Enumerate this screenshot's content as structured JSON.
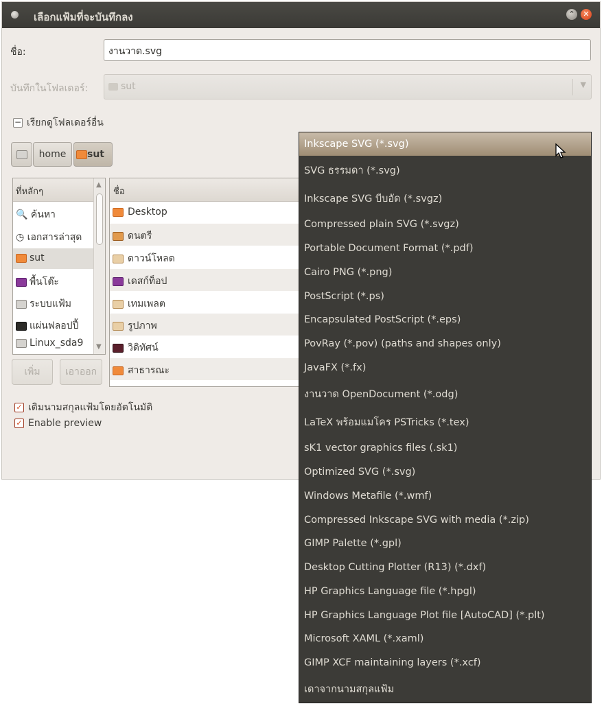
{
  "window": {
    "title": "เลือกแฟ้มที่จะบันทึกลง"
  },
  "form": {
    "name_label": "ชื่อ:",
    "name_value": "งานวาด.svg",
    "folder_label": "บันทึกในโฟลเดอร์:",
    "folder_value": "sut",
    "browse_toggle": "เรียกดูโฟลเดอร์อื่น"
  },
  "path_bar": [
    {
      "label": "",
      "icon": "drive-icon"
    },
    {
      "label": "home",
      "icon": ""
    },
    {
      "label": "sut",
      "icon": "home-folder-icon"
    }
  ],
  "places": {
    "header": "ที่หลักๆ",
    "items": [
      {
        "label": "ค้นหา",
        "icon": "search-icon"
      },
      {
        "label": "เอกสารล่าสุด",
        "icon": "recent-icon"
      },
      {
        "label": "sut",
        "icon": "home-folder-icon"
      },
      {
        "label": "พื้นโต๊ะ",
        "icon": "desktop-icon"
      },
      {
        "label": "ระบบแฟ้ม",
        "icon": "filesystem-icon"
      },
      {
        "label": "แผ่นฟลอปปี้",
        "icon": "floppy-icon"
      },
      {
        "label": "Linux_sda9",
        "icon": "drive-icon"
      }
    ],
    "add_button": "เพิ่ม",
    "remove_button": "เอาออก"
  },
  "files": {
    "header": "ชื่อ",
    "rows": [
      {
        "name": "Desktop",
        "icon": "folder-icon"
      },
      {
        "name": "ดนตรี",
        "icon": "music-folder-icon"
      },
      {
        "name": "ดาวน์โหลด",
        "icon": "download-folder-icon"
      },
      {
        "name": "เดสก์ท็อป",
        "icon": "desktop-folder-icon"
      },
      {
        "name": "เทมเพลต",
        "icon": "templates-folder-icon"
      },
      {
        "name": "รูปภาพ",
        "icon": "pictures-folder-icon"
      },
      {
        "name": "วิดิทัศน์",
        "icon": "videos-folder-icon"
      },
      {
        "name": "สาธารณะ",
        "icon": "public-folder-icon"
      }
    ]
  },
  "options": {
    "auto_extension": "เติมนามสกุลแฟ้มโดยอัตโนมัติ",
    "auto_extension_checked": true,
    "enable_preview": "Enable preview",
    "enable_preview_checked": true
  },
  "filetype_menu": {
    "selected_index": 0,
    "items": [
      "Inkscape SVG (*.svg)",
      "SVG ธรรมดา (*.svg)",
      "Inkscape SVG บีบอัด (*.svgz)",
      "Compressed plain SVG (*.svgz)",
      "Portable Document Format (*.pdf)",
      "Cairo PNG (*.png)",
      "PostScript (*.ps)",
      "Encapsulated PostScript (*.eps)",
      "PovRay (*.pov) (paths and shapes only)",
      "JavaFX (*.fx)",
      "งานวาด OpenDocument (*.odg)",
      "LaTeX พร้อมแมโคร PSTricks (*.tex)",
      "sK1 vector graphics files (.sk1)",
      "Optimized SVG (*.svg)",
      "Windows Metafile (*.wmf)",
      "Compressed Inkscape SVG with media (*.zip)",
      "GIMP Palette (*.gpl)",
      "Desktop Cutting Plotter (R13) (*.dxf)",
      "HP Graphics Language file (*.hpgl)",
      "HP Graphics Language Plot file [AutoCAD] (*.plt)",
      "Microsoft XAML (*.xaml)",
      "GIMP XCF maintaining layers (*.xcf)",
      "เดาจากนามสกุลแฟ้ม"
    ]
  }
}
